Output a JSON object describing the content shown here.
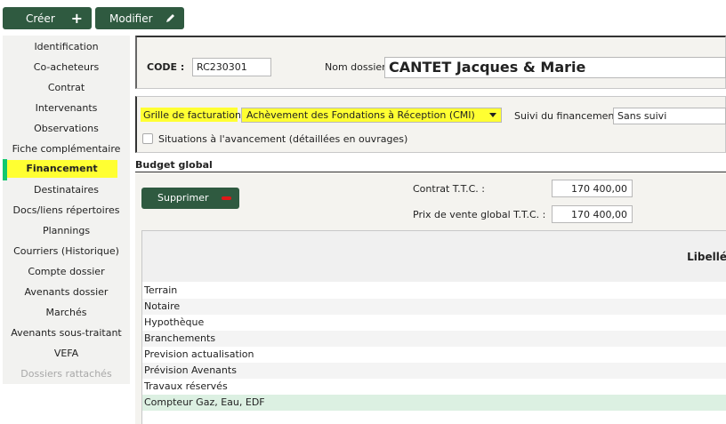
{
  "toolbar": {
    "create_label": "Créer",
    "create_icon": "plus-icon",
    "modify_label": "Modifier",
    "modify_icon": "pencil-icon"
  },
  "sidebar": {
    "items": [
      {
        "label": "Identification"
      },
      {
        "label": "Co-acheteurs"
      },
      {
        "label": "Contrat"
      },
      {
        "label": "Intervenants"
      },
      {
        "label": "Observations"
      },
      {
        "label": "Fiche complémentaire"
      },
      {
        "label": "Financement",
        "active": true
      },
      {
        "label": "Destinataires"
      },
      {
        "label": "Docs/liens répertoires"
      },
      {
        "label": "Plannings"
      },
      {
        "label": "Courriers (Historique)"
      },
      {
        "label": "Compte dossier"
      },
      {
        "label": "Avenants dossier"
      },
      {
        "label": "Marchés"
      },
      {
        "label": "Avenants sous-traitant"
      },
      {
        "label": "VEFA"
      },
      {
        "label": "Dossiers rattachés",
        "disabled": true
      }
    ]
  },
  "header": {
    "code_label": "CODE :",
    "code_value": "RC230301",
    "dossier_label": "Nom dossier :",
    "dossier_value": "CANTET Jacques & Marie"
  },
  "facturation": {
    "grille_label": "Grille de facturation :",
    "grille_value": "Achèvement des Fondations à Réception (CMI)",
    "suivi_label": "Suivi du financement :",
    "suivi_value": "Sans suivi",
    "situations_label": "Situations à l'avancement (détaillées en ouvrages)",
    "situations_checked": false
  },
  "budget": {
    "title": "Budget global",
    "delete_label": "Supprimer",
    "contrat_label": "Contrat T.T.C. :",
    "contrat_value": "170 400,00",
    "prix_label": "Prix de vente global T.T.C. :",
    "prix_value": "170 400,00",
    "column_label": "Libellé",
    "rows": [
      {
        "label": "Terrain"
      },
      {
        "label": "Notaire"
      },
      {
        "label": "Hypothèque"
      },
      {
        "label": "Branchements"
      },
      {
        "label": "Prevision actualisation"
      },
      {
        "label": "Prévision Avenants"
      },
      {
        "label": "Travaux réservés"
      },
      {
        "label": "Compteur Gaz, Eau, EDF",
        "selected": true
      }
    ]
  },
  "colors": {
    "button": "#2f5a40",
    "highlight": "#ffff32",
    "active_marker": "#12c86e",
    "panel_bg": "#f4f3ef"
  }
}
